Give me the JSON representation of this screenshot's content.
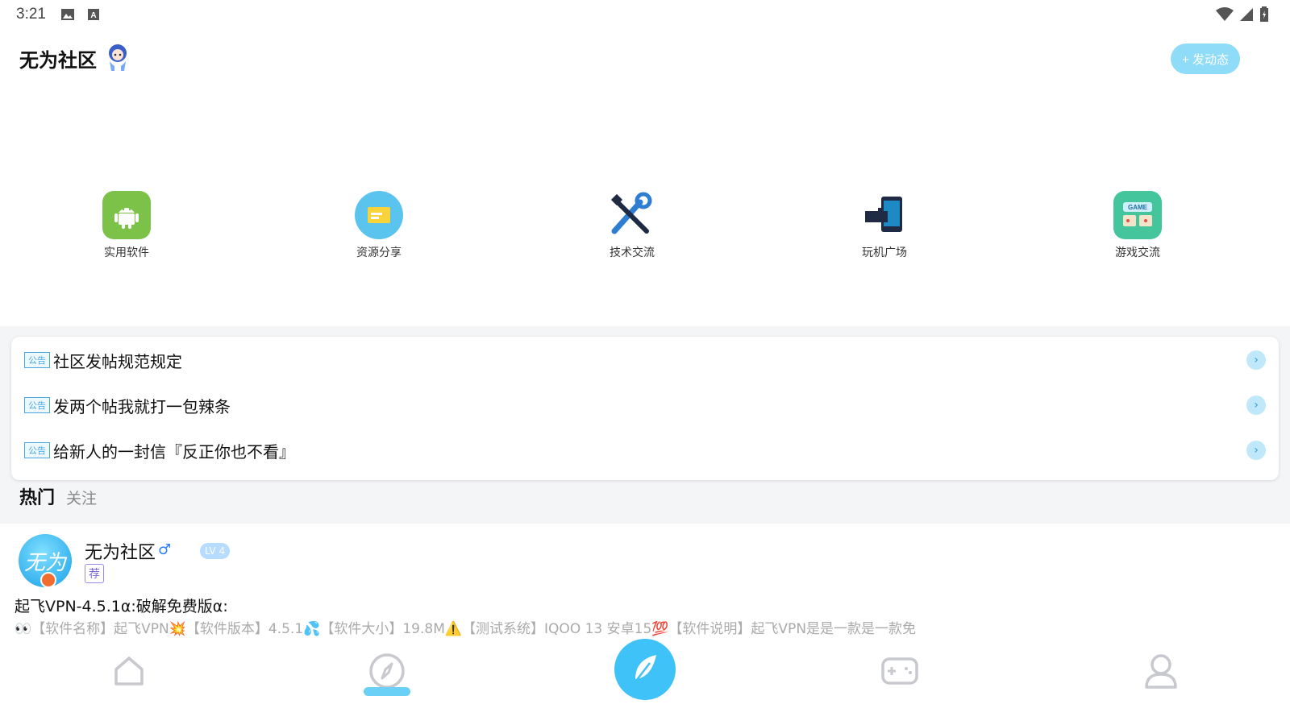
{
  "status_bar": {
    "time": "3:21",
    "icons": [
      "image-icon",
      "a-letter-icon",
      "wifi-icon",
      "signal-icon",
      "battery-icon"
    ]
  },
  "header": {
    "title": "无为社区",
    "post_button": "+ 发动态"
  },
  "categories": [
    {
      "label": "实用软件",
      "icon": "android-icon",
      "color": "#7cc249"
    },
    {
      "label": "资源分享",
      "icon": "folder-icon",
      "color": "#5bc4ee"
    },
    {
      "label": "技术交流",
      "icon": "tools-icon",
      "color": "#2d7dd2"
    },
    {
      "label": "玩机广场",
      "icon": "phone-puzzle-icon",
      "color": "#1d8ac6"
    },
    {
      "label": "游戏交流",
      "icon": "game-icon",
      "color": "#45c59b"
    }
  ],
  "notices": {
    "tag": "公告",
    "items": [
      {
        "text": "社区发帖规范规定"
      },
      {
        "text": "发两个帖我就打一包辣条"
      },
      {
        "text": "给新人的一封信『反正你也不看』"
      }
    ]
  },
  "tabs": {
    "hot": "热门",
    "follow": "关注"
  },
  "post": {
    "avatar_text": "无为",
    "username": "无为社区",
    "gender": "♂",
    "level_prefix": "LV",
    "level": "4",
    "recommend_tag": "荐",
    "title": "起飞VPN-4.5.1α:破解免费版α:",
    "description": "👀【软件名称】起飞VPN💥【软件版本】4.5.1💦【软件大小】19.8M⚠️【测试系统】IQOO 13 安卓15💯【软件说明】起飞VPN是是一款是一款免"
  },
  "bottom_nav": {
    "items": [
      "home-icon",
      "compass-icon",
      "feather-icon",
      "gamepad-icon",
      "profile-icon"
    ],
    "active": "compass-icon",
    "accent": "#3ec2f7"
  }
}
